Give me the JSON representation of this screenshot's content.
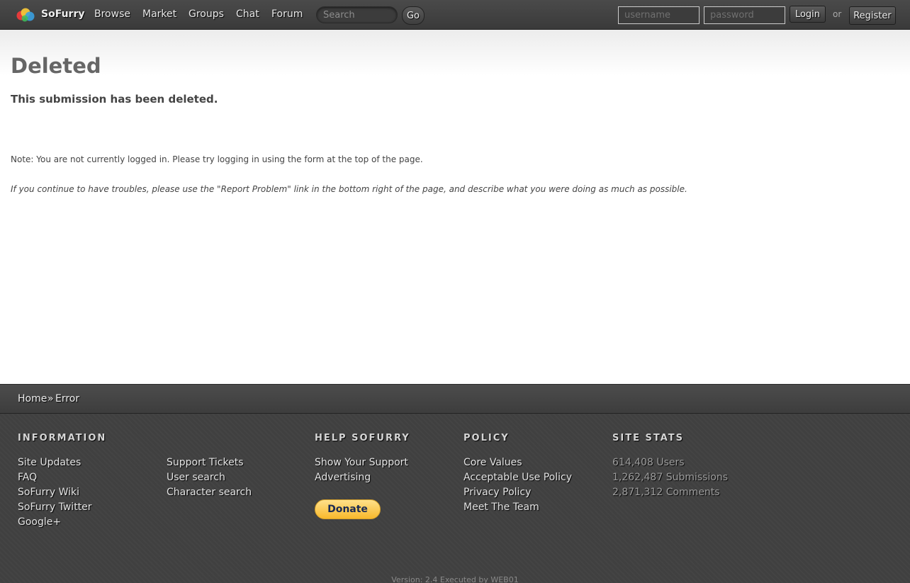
{
  "header": {
    "brand": "SoFurry",
    "nav": [
      "Browse",
      "Market",
      "Groups",
      "Chat",
      "Forum"
    ],
    "search_placeholder": "Search",
    "go_label": "Go",
    "username_placeholder": "username",
    "password_placeholder": "password",
    "login_label": "Login",
    "or_text": "or",
    "register_label": "Register"
  },
  "main": {
    "title": "Deleted",
    "message": "This submission has been deleted.",
    "note": "Note: You are not currently logged in. Please try logging in using the form at the top of the page.",
    "help_note": "If you continue to have troubles, please use the \"Report Problem\" link in the bottom right of the page, and describe what you were doing as much as possible."
  },
  "breadcrumb": {
    "home": "Home",
    "separator": "»",
    "current": "Error"
  },
  "footer": {
    "information": {
      "heading": "INFORMATION",
      "col1": [
        "Site Updates",
        "FAQ",
        "SoFurry Wiki",
        "SoFurry Twitter",
        "Google+"
      ],
      "col2": [
        "Support Tickets",
        "User search",
        "Character search"
      ]
    },
    "help": {
      "heading": "HELP SOFURRY",
      "links": [
        "Show Your Support",
        "Advertising"
      ],
      "donate_label": "Donate"
    },
    "policy": {
      "heading": "POLICY",
      "links": [
        "Core Values",
        "Acceptable Use Policy",
        "Privacy Policy",
        "Meet The Team"
      ]
    },
    "stats": {
      "heading": "SITE STATS",
      "items": [
        "614,408 Users",
        "1,262,487 Submissions",
        "2,871,312 Comments"
      ]
    },
    "version": "Version: 2.4 Executed by WEB01"
  },
  "colors": {
    "header_bg": "#3f3f3f",
    "footer_bg": "#404040",
    "donate_yellow": "#f8b92c"
  }
}
